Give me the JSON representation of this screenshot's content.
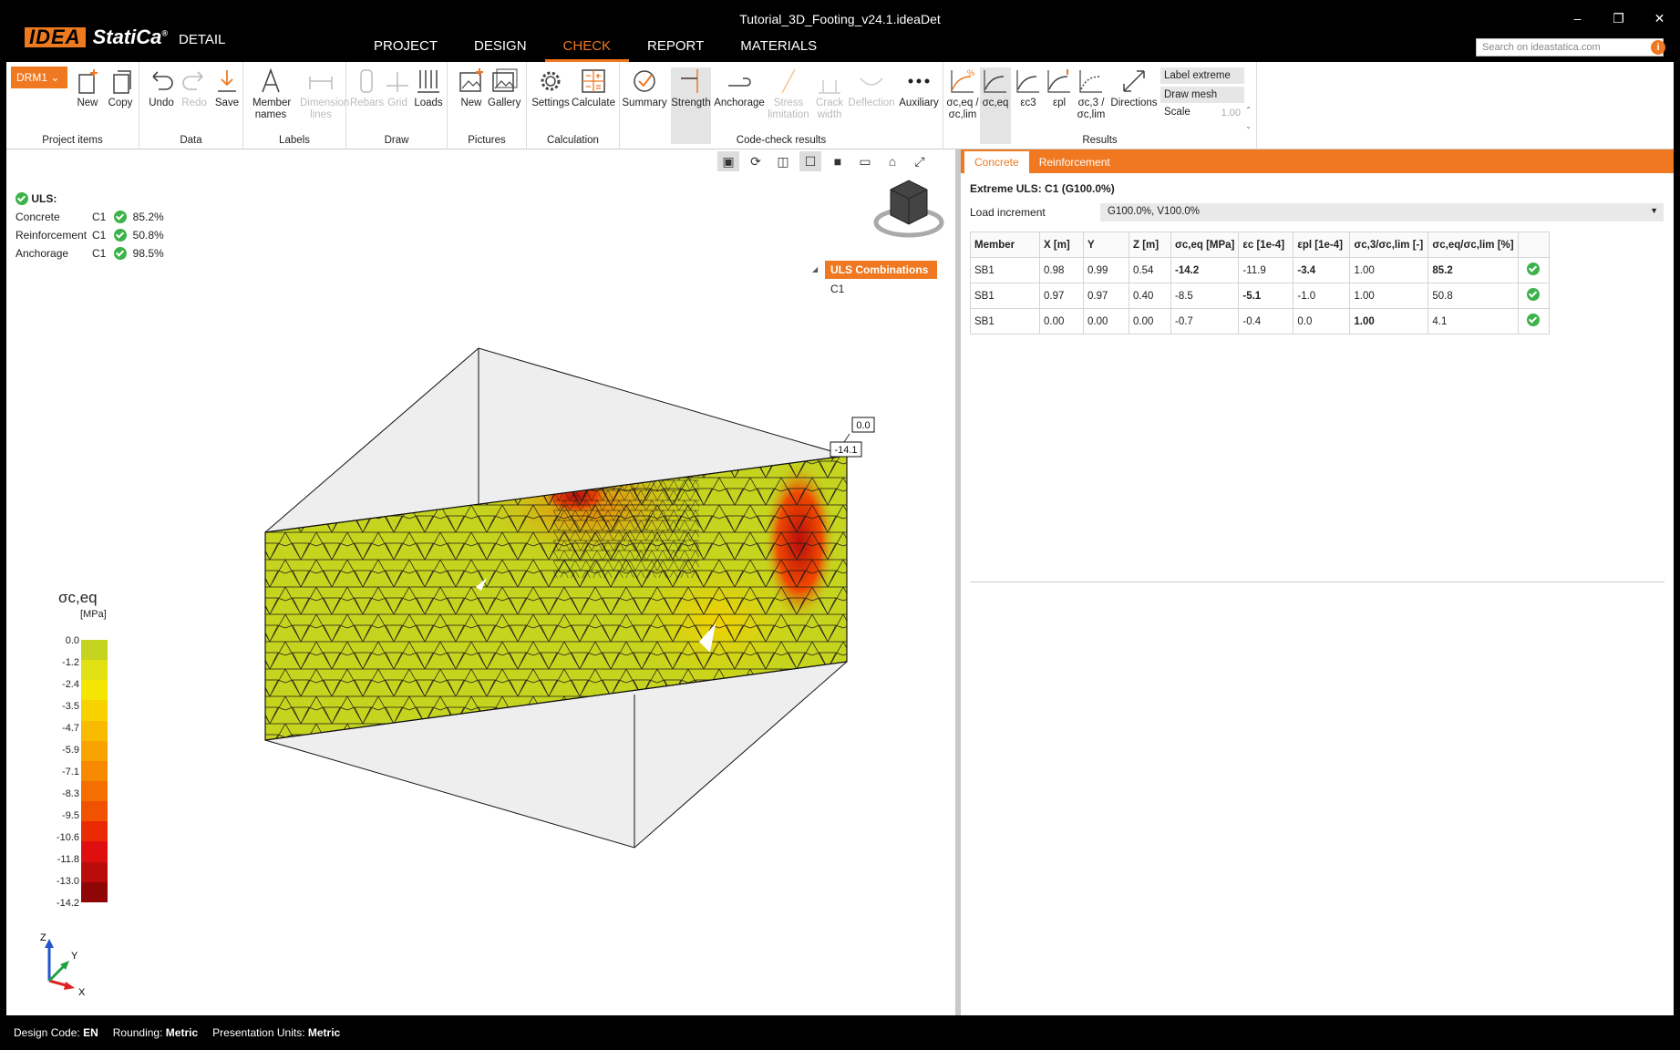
{
  "app": {
    "brand_idea": "IDEA",
    "brand_statica": "StatiCa",
    "brand_reg": "®",
    "module": "DETAIL",
    "document_title": "Tutorial_3D_Footing_v24.1.ideaDet"
  },
  "menu": [
    "PROJECT",
    "DESIGN",
    "CHECK",
    "REPORT",
    "MATERIALS"
  ],
  "search": {
    "placeholder": "Search on ideastatica.com"
  },
  "ribbon": {
    "drm": "DRM1",
    "groups": {
      "project_items": "Project items",
      "data": "Data",
      "labels": "Labels",
      "draw": "Draw",
      "pictures": "Pictures",
      "calculation": "Calculation",
      "code_check": "Code-check results",
      "results": "Results"
    },
    "buttons": {
      "new": "New",
      "copy": "Copy",
      "undo": "Undo",
      "redo": "Redo",
      "save": "Save",
      "member_names": "Member names",
      "dimension_lines": "Dimension lines",
      "rebars": "Rebars",
      "grid": "Grid",
      "loads": "Loads",
      "pic_new": "New",
      "gallery": "Gallery",
      "settings": "Settings",
      "calculate": "Calculate",
      "summary": "Summary",
      "strength": "Strength",
      "anchorage": "Anchorage",
      "stress_limitation": "Stress limitation",
      "crack_width": "Crack width",
      "deflection": "Deflection",
      "auxiliary": "Auxiliary",
      "sceq_lim": "σc,eq / σc,lim",
      "sceq": "σc,eq",
      "ec3": "εc3",
      "epl": "εpl",
      "sc3_lim": "σc,3 / σc,lim",
      "directions": "Directions"
    },
    "label_extreme": "Label extreme",
    "draw_mesh": "Draw mesh",
    "scale_label": "Scale",
    "scale_value": "1.00"
  },
  "uls": {
    "title": "ULS:",
    "rows": [
      {
        "name": "Concrete",
        "combo": "C1",
        "value": "85.2%"
      },
      {
        "name": "Reinforcement",
        "combo": "C1",
        "value": "50.8%"
      },
      {
        "name": "Anchorage",
        "combo": "C1",
        "value": "98.5%"
      }
    ]
  },
  "combinations": {
    "header": "ULS Combinations",
    "items": [
      "C1"
    ]
  },
  "model_labels": {
    "max": "0.0",
    "min": "-14.1"
  },
  "legend": {
    "title": "σc,eq",
    "unit": "[MPa]",
    "values": [
      "0.0",
      "-1.2",
      "-2.4",
      "-3.5",
      "-4.7",
      "-5.9",
      "-7.1",
      "-8.3",
      "-9.5",
      "-10.6",
      "-11.8",
      "-13.0",
      "-14.2"
    ],
    "colors": [
      "#c5d41e",
      "#e0e012",
      "#f4e600",
      "#f7d100",
      "#f8bb00",
      "#f8a300",
      "#f78a00",
      "#f46e00",
      "#f05200",
      "#ea2a00",
      "#df0f0f",
      "#bb0c0c",
      "#8f0606"
    ]
  },
  "axes": {
    "z": "Z",
    "y": "Y",
    "x": "X"
  },
  "panel": {
    "tabs": [
      "Concrete",
      "Reinforcement"
    ],
    "extreme": "Extreme ULS: C1 (G100.0%)",
    "load_increment_label": "Load increment",
    "load_increment_value": "G100.0%, V100.0%"
  },
  "table": {
    "headers": [
      "Member",
      "X [m]",
      "Y",
      "Z [m]",
      "σc,eq [MPa]",
      "εc [1e-4]",
      "εpl [1e-4]",
      "σc,3/σc,lim [-]",
      "σc,eq/σc,lim [%]",
      ""
    ],
    "rows": [
      [
        "SB1",
        "0.98",
        "0.99",
        "0.54",
        "-14.2",
        "-11.9",
        "-3.4",
        "1.00",
        "85.2"
      ],
      [
        "SB1",
        "0.97",
        "0.97",
        "0.40",
        "-8.5",
        "-5.1",
        "-1.0",
        "1.00",
        "50.8"
      ],
      [
        "SB1",
        "0.00",
        "0.00",
        "0.00",
        "-0.7",
        "-0.4",
        "0.0",
        "1.00",
        "4.1"
      ]
    ]
  },
  "status": {
    "design_code_label": "Design Code:",
    "design_code": "EN",
    "rounding_label": "Rounding:",
    "rounding": "Metric",
    "units_label": "Presentation Units:",
    "units": "Metric"
  },
  "colors": {
    "accent": "#f07820",
    "ok": "#3cb34a",
    "mesh_base": "#c5d41e"
  }
}
